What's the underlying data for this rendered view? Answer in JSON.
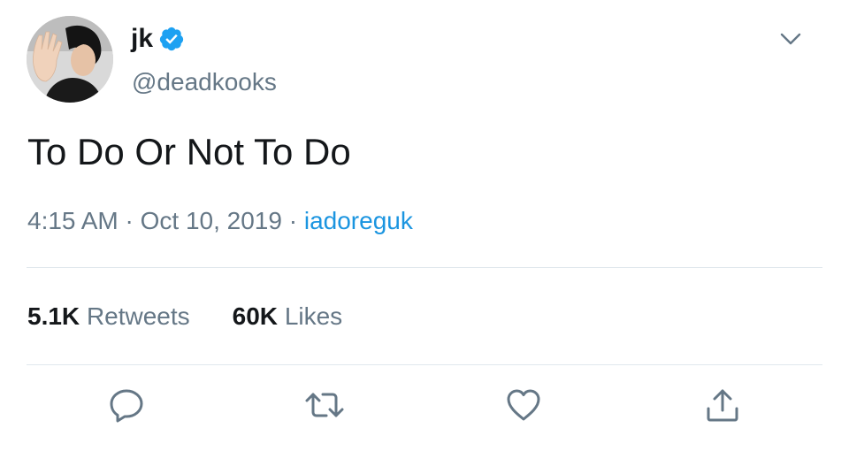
{
  "author": {
    "display_name": "jk",
    "handle": "@deadkooks",
    "verified": true,
    "avatar": "profile-photo"
  },
  "tweet": {
    "text": "To Do Or Not To Do",
    "time": "4:15 AM",
    "separator": "·",
    "date": "Oct 10, 2019",
    "source": "iadoreguk"
  },
  "stats": {
    "retweets_count": "5.1K",
    "retweets_label": "Retweets",
    "likes_count": "60K",
    "likes_label": "Likes"
  },
  "actions": [
    {
      "icon": "reply-icon"
    },
    {
      "icon": "retweet-icon"
    },
    {
      "icon": "like-icon"
    },
    {
      "icon": "share-icon"
    }
  ],
  "colors": {
    "text": "#14171a",
    "secondary": "#657786",
    "link": "#1b95e0",
    "verified": "#1da1f2",
    "divider": "#e1e8ed"
  }
}
